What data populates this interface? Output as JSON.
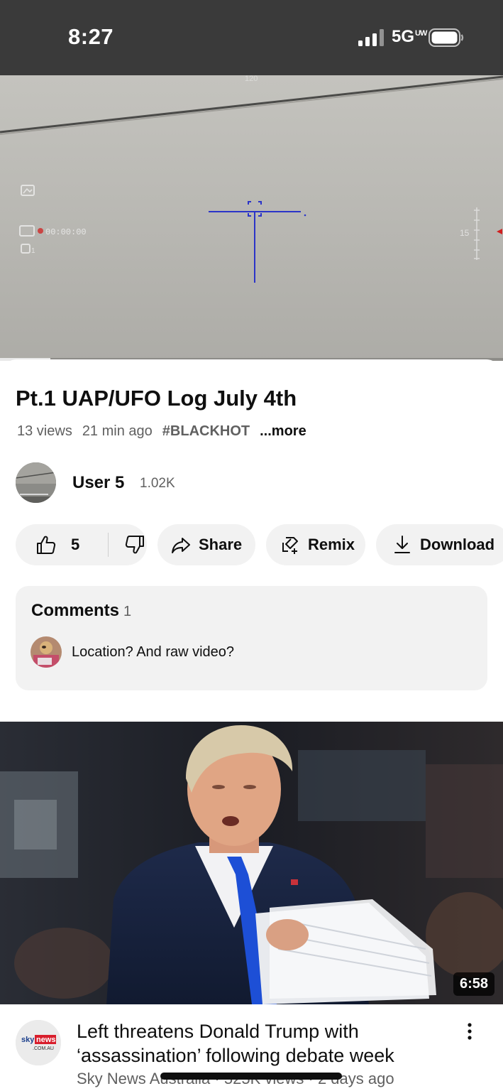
{
  "status_bar": {
    "time": "8:27",
    "network": "5G",
    "network_suffix": "UW",
    "signal_icon": "cellular-signal-icon",
    "battery_icon": "battery-icon"
  },
  "player": {
    "overlay_top_text": "120",
    "record_time": "00:00:00",
    "scale_value": "15",
    "progress": 0.1
  },
  "video": {
    "title": "Pt.1 UAP/UFO Log July 4th",
    "views": "13 views",
    "age": "21 min ago",
    "hashtag": "#BLACKHOT",
    "more_label": "...more"
  },
  "channel": {
    "name": "User 5",
    "subscribers": "1.02K"
  },
  "actions": {
    "like_count": "5",
    "share_label": "Share",
    "remix_label": "Remix",
    "download_label": "Download"
  },
  "comments": {
    "title": "Comments",
    "count": "1",
    "top_comment": "Location? And raw video?"
  },
  "next_video": {
    "duration": "6:58",
    "title": "Left threatens Donald Trump with ‘assassination’ following debate week",
    "channel": "Sky News Australia",
    "views": "525K views",
    "age": "2 days ago",
    "avatar_text_1": "sky",
    "avatar_text_2": "news",
    "avatar_text_3": ".COM.AU"
  },
  "colors": {
    "status_bar_bg": "#3a3a3a",
    "pill_bg": "#f2f2f2",
    "reticle": "#2b34c8",
    "secondary_text": "#606060"
  }
}
